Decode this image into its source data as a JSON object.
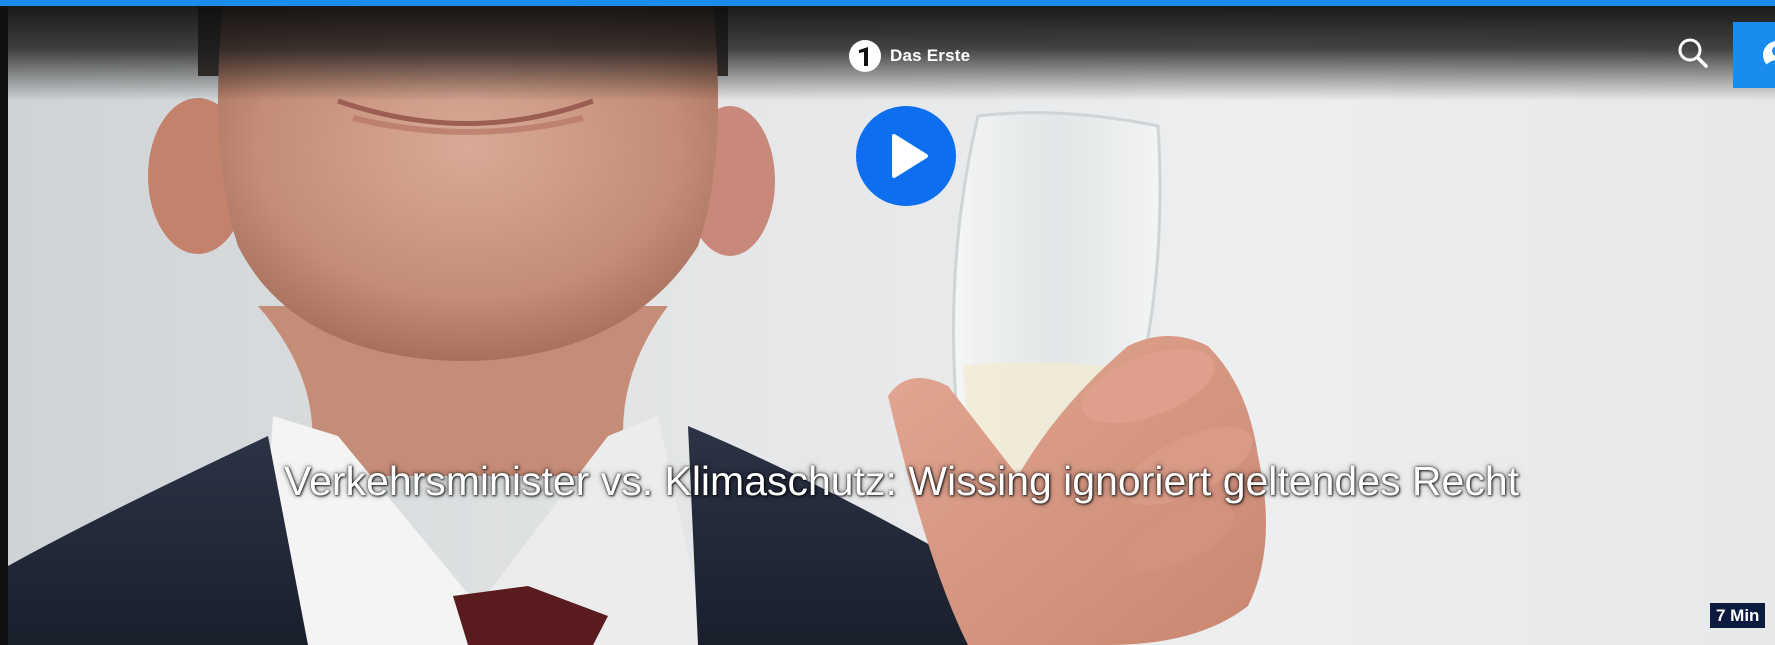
{
  "header": {
    "logo_text": "Das Erste",
    "search_icon": "search-icon",
    "account_icon": "user-icon"
  },
  "video": {
    "title": "Verkehrsminister vs. Klimaschutz: Wissing ignoriert geltendes Recht",
    "duration": "7 Min",
    "play_icon": "play-icon"
  },
  "colors": {
    "accent": "#1a8cf0",
    "play_button": "#0d6ef0",
    "duration_badge": "#0c1a40"
  }
}
